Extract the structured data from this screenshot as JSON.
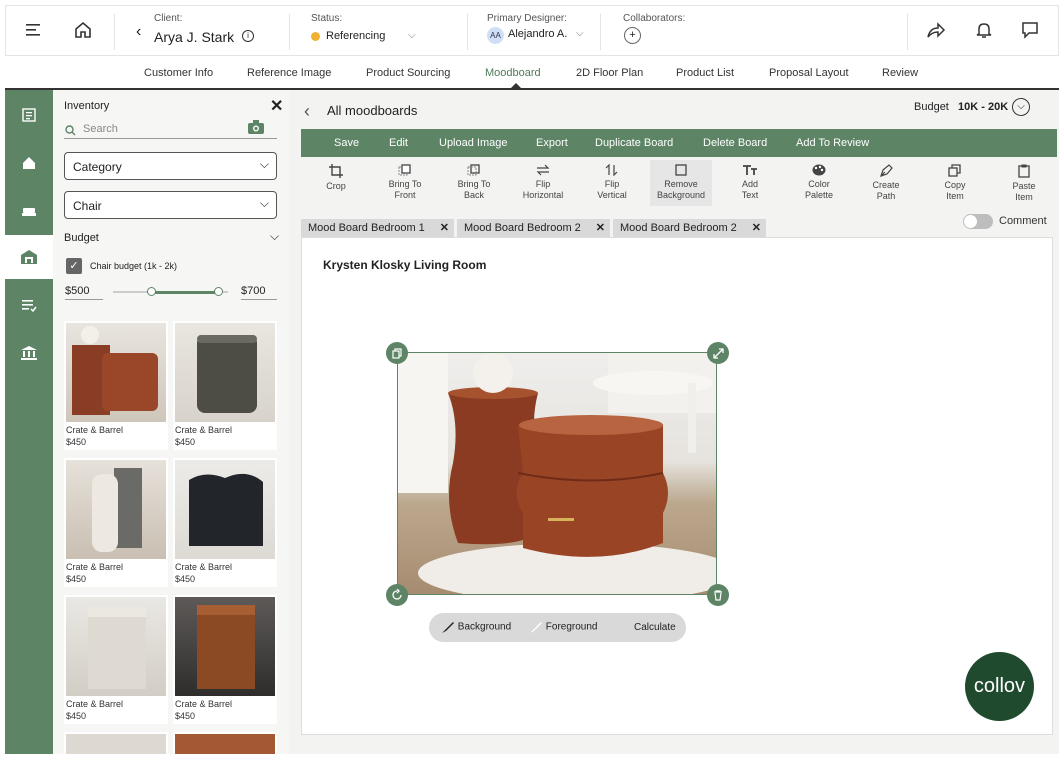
{
  "header": {
    "client_label": "Client:",
    "client_name": "Arya J. Stark",
    "status_label": "Status:",
    "status_value": "Referencing",
    "designer_label": "Primary Designer:",
    "designer_initials": "AA",
    "designer_name": "Alejandro A.",
    "collaborators_label": "Collaborators:",
    "add_symbol": "+"
  },
  "tabs": [
    "Customer Info",
    "Reference Image",
    "Product Sourcing",
    "Moodboard",
    "2D Floor Plan",
    "Product List",
    "Proposal Layout",
    "Review"
  ],
  "inventory": {
    "title": "Inventory",
    "search_placeholder": "Search",
    "category": "Category",
    "chair": "Chair",
    "budget_label": "Budget",
    "checkbox_label": "Chair budget (1k - 2k)",
    "min": "$500",
    "max": "$700",
    "slider_low_fraction": 0.33,
    "slider_high_fraction": 0.91,
    "products": [
      {
        "brand": "Crate & Barrel",
        "price": "$450"
      },
      {
        "brand": "Crate & Barrel",
        "price": "$450"
      },
      {
        "brand": "Crate & Barrel",
        "price": "$450"
      },
      {
        "brand": "Crate & Barrel",
        "price": "$450"
      },
      {
        "brand": "Crate & Barrel",
        "price": "$450"
      },
      {
        "brand": "Crate & Barrel",
        "price": "$450"
      }
    ]
  },
  "moodboard": {
    "back_title": "All moodboards",
    "budget_label": "Budget",
    "budget_value": "10K - 20K",
    "actions": [
      "Save",
      "Edit",
      "Upload Image",
      "Export",
      "Duplicate Board",
      "Delete Board",
      "Add To Review"
    ],
    "tools": [
      {
        "l1": "Crop",
        "l2": ""
      },
      {
        "l1": "Bring To",
        "l2": "Front"
      },
      {
        "l1": "Bring To",
        "l2": "Back"
      },
      {
        "l1": "Flip",
        "l2": "Horizontal"
      },
      {
        "l1": "Flip",
        "l2": "Vertical"
      },
      {
        "l1": "Remove",
        "l2": "Background"
      },
      {
        "l1": "Add",
        "l2": "Text"
      },
      {
        "l1": "Color",
        "l2": "Palette"
      },
      {
        "l1": "Create",
        "l2": "Path"
      },
      {
        "l1": "Copy",
        "l2": "Item"
      },
      {
        "l1": "Paste",
        "l2": "Item"
      }
    ],
    "board_tabs": [
      "Mood Board Bedroom 1",
      "Mood Board Bedroom 2",
      "Mood Board Bedroom 2"
    ],
    "comment_label": "Comment",
    "board_title": "Krysten Klosky Living Room",
    "edit_bar": {
      "background": "Background",
      "foreground": "Foreground",
      "calculate": "Calculate"
    },
    "logo": "collov"
  },
  "colors": {
    "brand_green": "#5c8465",
    "status_dot": "#f2b02f",
    "logo_bg": "#1f4a2d"
  }
}
